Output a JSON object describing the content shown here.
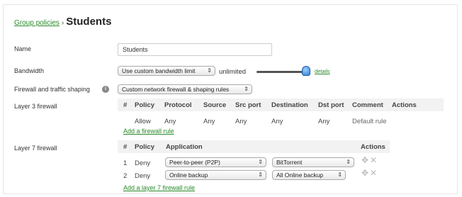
{
  "breadcrumb": {
    "parent": "Group policies",
    "separator": "›",
    "title": "Students"
  },
  "name": {
    "label": "Name",
    "value": "Students"
  },
  "bandwidth": {
    "label": "Bandwidth",
    "select_value": "Use custom bandwidth limit",
    "limit_text": "unlimited",
    "slider_level": 1.0,
    "details_link": "details"
  },
  "firewall_shaping": {
    "label": "Firewall and traffic shaping",
    "help_icon": "i",
    "select_value": "Custom network firewall & shaping rules"
  },
  "layer3": {
    "label": "Layer 3 firewall",
    "headers": [
      "#",
      "Policy",
      "Protocol",
      "Source",
      "Src port",
      "Destination",
      "Dst port",
      "Comment",
      "Actions"
    ],
    "rows": [
      {
        "num": "",
        "policy": "Allow",
        "protocol": "Any",
        "source": "Any",
        "src_port": "Any",
        "destination": "Any",
        "dst_port": "Any",
        "comment": "Default rule"
      }
    ],
    "add_link": "Add a firewall rule"
  },
  "layer7": {
    "label": "Layer 7 firewall",
    "headers": [
      "#",
      "Policy",
      "Application",
      "Actions"
    ],
    "rows": [
      {
        "num": "1",
        "policy": "Deny",
        "category": "Peer-to-peer (P2P)",
        "application": "BitTorrent"
      },
      {
        "num": "2",
        "policy": "Deny",
        "category": "Online backup",
        "application": "All Online backup"
      }
    ],
    "add_link": "Add a layer 7 firewall rule"
  }
}
